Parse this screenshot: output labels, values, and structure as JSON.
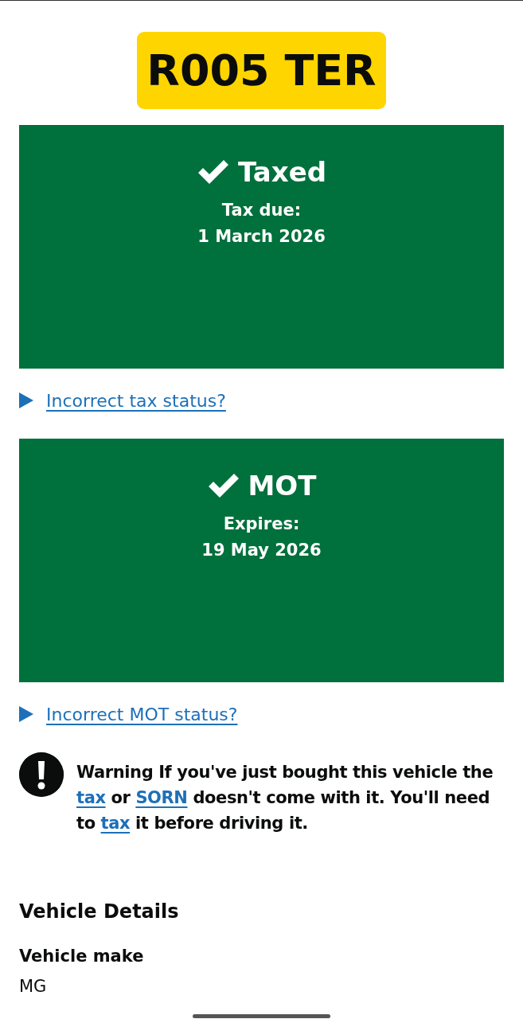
{
  "plate": "R005 TER",
  "statuses": [
    {
      "valid": true,
      "title": "Taxed",
      "label": "Tax due:",
      "date": "1 March 2026",
      "details_link": "Incorrect tax status?"
    },
    {
      "valid": true,
      "title": "MOT",
      "label": "Expires:",
      "date": "19 May 2026",
      "details_link": "Incorrect MOT status?"
    }
  ],
  "warning": {
    "segments": [
      {
        "kind": "text",
        "text": "Warning If you've just bought this vehicle the "
      },
      {
        "kind": "link",
        "text": "tax"
      },
      {
        "kind": "text",
        "text": " or "
      },
      {
        "kind": "link",
        "text": "SORN"
      },
      {
        "kind": "text",
        "text": " doesn't come with it. You'll need to "
      },
      {
        "kind": "link",
        "text": "tax"
      },
      {
        "kind": "text",
        "text": " it before driving it."
      }
    ]
  },
  "vehicle_details": {
    "heading": "Vehicle Details",
    "rows": [
      {
        "label": "Vehicle make",
        "value": "MG"
      }
    ]
  }
}
